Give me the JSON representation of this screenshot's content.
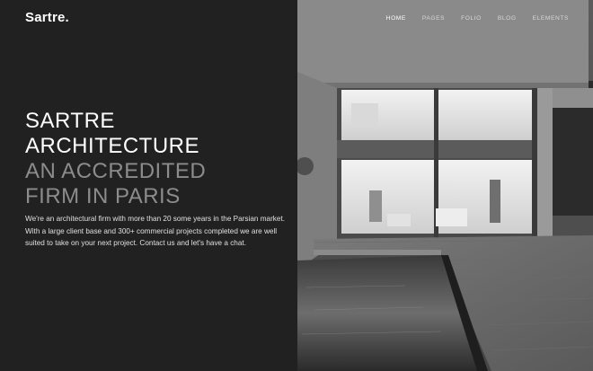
{
  "brand": {
    "logo": "Sartre."
  },
  "nav": {
    "items": [
      "HOME",
      "PAGES",
      "FOLIO",
      "BLOG",
      "ELEMENTS"
    ],
    "active": "HOME"
  },
  "hero": {
    "headline": [
      "SARTRE",
      "ARCHITECTURE",
      "AN ACCREDITED",
      "FIRM IN PARIS"
    ],
    "description": "We're an architectural firm with more than 20 some years in the Parsian market. With a large client base and 300+ commercial projects completed we are well suited to take on your next project. Contact us and let's have a chat."
  },
  "colors": {
    "left_panel": "#212121",
    "headline_white": "#ffffff",
    "headline_gray": "#8c8c8c"
  },
  "image": {
    "subject": "modern-concrete-house-with-pool",
    "tone": "grayscale"
  }
}
